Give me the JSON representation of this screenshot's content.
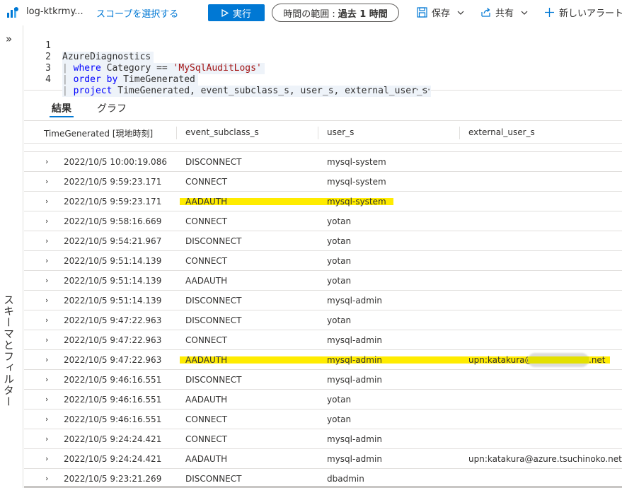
{
  "toolbar": {
    "workspace_name": "log-ktkrmy...",
    "scope_link": "スコープを選択する",
    "run_label": "実行",
    "time_range_label": "時間の範囲 :",
    "time_range_value": "過去 1 時間",
    "save_label": "保存",
    "share_label": "共有",
    "new_alert_label": "新しいアラート ルール"
  },
  "sidebar": {
    "label": "スキーマとフィルター"
  },
  "editor": {
    "lines": [
      {
        "num": "1",
        "text": "AzureDiagnostics"
      },
      {
        "num": "2",
        "pipe": "|",
        "kw": "where",
        "rest": " Category == ",
        "str": "'MySqlAuditLogs'"
      },
      {
        "num": "3",
        "pipe": "|",
        "kw": "order by",
        "rest": " TimeGenerated"
      },
      {
        "num": "4",
        "pipe": "|",
        "kw": "project",
        "rest": " TimeGenerated, event_subclass_s, user_s, external_user_s"
      }
    ]
  },
  "tabs": {
    "results": "結果",
    "chart": "グラフ"
  },
  "table": {
    "columns": [
      "TimeGenerated [現地時刻]",
      "event_subclass_s",
      "user_s",
      "external_user_s"
    ],
    "rows": [
      {
        "time": "2022/10/5 10:00:19.086",
        "event": "DISCONNECT",
        "user": "mysql-system",
        "external": ""
      },
      {
        "time": "2022/10/5 9:59:23.171",
        "event": "CONNECT",
        "user": "mysql-system",
        "external": ""
      },
      {
        "time": "2022/10/5 9:59:23.171",
        "event": "AADAUTH",
        "user": "mysql-system",
        "external": "",
        "highlight": true
      },
      {
        "time": "2022/10/5 9:58:16.669",
        "event": "CONNECT",
        "user": "yotan",
        "external": ""
      },
      {
        "time": "2022/10/5 9:54:21.967",
        "event": "DISCONNECT",
        "user": "yotan",
        "external": ""
      },
      {
        "time": "2022/10/5 9:51:14.139",
        "event": "CONNECT",
        "user": "yotan",
        "external": ""
      },
      {
        "time": "2022/10/5 9:51:14.139",
        "event": "AADAUTH",
        "user": "yotan",
        "external": ""
      },
      {
        "time": "2022/10/5 9:51:14.139",
        "event": "DISCONNECT",
        "user": "mysql-admin",
        "external": ""
      },
      {
        "time": "2022/10/5 9:47:22.963",
        "event": "DISCONNECT",
        "user": "yotan",
        "external": ""
      },
      {
        "time": "2022/10/5 9:47:22.963",
        "event": "CONNECT",
        "user": "mysql-admin",
        "external": ""
      },
      {
        "time": "2022/10/5 9:47:22.963",
        "event": "AADAUTH",
        "user": "mysql-admin",
        "external": "upn:katakura@a",
        "external_suffix": ".net",
        "highlight": true,
        "redacted": true
      },
      {
        "time": "2022/10/5 9:46:16.551",
        "event": "DISCONNECT",
        "user": "mysql-admin",
        "external": ""
      },
      {
        "time": "2022/10/5 9:46:16.551",
        "event": "AADAUTH",
        "user": "yotan",
        "external": ""
      },
      {
        "time": "2022/10/5 9:46:16.551",
        "event": "CONNECT",
        "user": "yotan",
        "external": ""
      },
      {
        "time": "2022/10/5 9:24:24.421",
        "event": "CONNECT",
        "user": "mysql-admin",
        "external": ""
      },
      {
        "time": "2022/10/5 9:24:24.421",
        "event": "AADAUTH",
        "user": "mysql-admin",
        "external": "upn:katakura@azure.tsuchinoko.net"
      },
      {
        "time": "2022/10/5 9:23:21.269",
        "event": "DISCONNECT",
        "user": "dbadmin",
        "external": ""
      }
    ]
  },
  "colors": {
    "accent": "#0078d4",
    "highlight": "#ffec00"
  }
}
